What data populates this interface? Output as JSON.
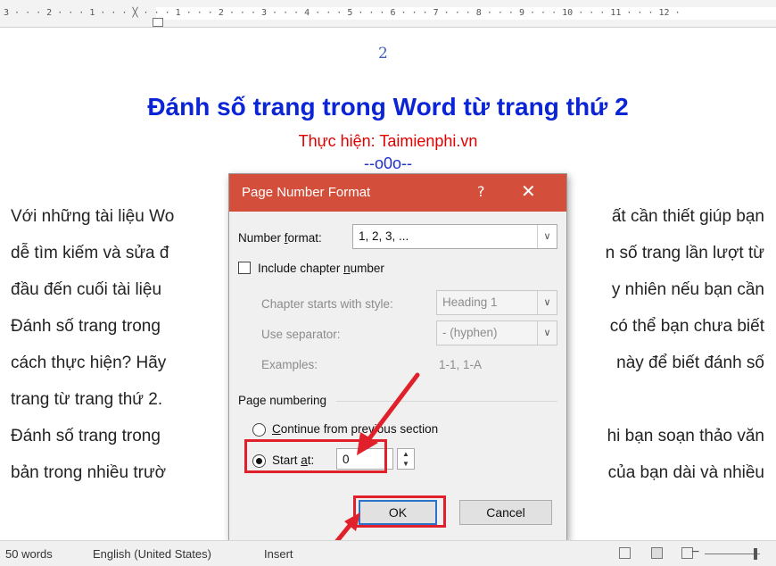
{
  "ruler": {
    "scale_text": "3 · · · 2 · · · 1 · · · ╳ · · · 1 · · · 2 · · · 3 · · · 4 · · · 5 · · · 6 · · · 7 · · · 8 · · · 9 · · · 10 · · · 11 · · · 12 ·"
  },
  "document": {
    "page_number": "2",
    "title": "Đánh số trang trong Word từ trang thứ 2",
    "subtitle": "Thực hiện: Taimienphi.vn",
    "separator": "--o0o--",
    "paragraph_lines": [
      {
        "left": "Với những tài liệu Wo",
        "right": "ất cần thiết giúp bạn"
      },
      {
        "left": "dễ tìm kiếm và sửa đ",
        "right": "n số trang lần lượt từ"
      },
      {
        "left": "đầu đến cuối tài liệu",
        "right": "y nhiên nếu bạn cần"
      },
      {
        "left": "Đánh số trang trong",
        "right": "có thể bạn chưa biết"
      },
      {
        "left": "cách thực hiện? Hãy",
        "right": "này để biết đánh số"
      },
      {
        "left": "trang từ trang thứ 2.",
        "right": ""
      },
      {
        "left": "Đánh số trang trong",
        "right": "hi bạn soạn thảo văn"
      },
      {
        "left": "bản trong nhiều trườ",
        "right": "của bạn dài và nhiều"
      }
    ]
  },
  "dialog": {
    "title": "Page Number Format",
    "help_glyph": "?",
    "close_glyph": "✕",
    "number_format_label_pre": "Number ",
    "number_format_label_u": "f",
    "number_format_label_post": "ormat:",
    "number_format_value": "1, 2, 3, ...",
    "include_chapter_pre": "Include chapter ",
    "include_chapter_u": "n",
    "include_chapter_post": "umber",
    "chapter_style_label": "Chapter starts with style:",
    "chapter_style_value": "Heading 1",
    "separator_label": "Use separator:",
    "separator_value": "-  (hyphen)",
    "examples_label": "Examples:",
    "examples_value": "1-1, 1-A",
    "page_numbering_label": "Page numbering",
    "continue_u": "C",
    "continue_post": "ontinue from previous section",
    "start_at_pre": "Start ",
    "start_at_u": "a",
    "start_at_post": "t:",
    "start_at_value": "0",
    "ok_label": "OK",
    "cancel_label": "Cancel",
    "number_format_selected": true,
    "start_at_selected": true
  },
  "status_bar": {
    "words": "50 words",
    "language": "English (United States)",
    "mode": "Insert"
  },
  "colors": {
    "title_bar": "#d44f3b",
    "doc_title": "#0b24d6",
    "subtitle": "#e00000",
    "highlight": "#e0202a"
  }
}
